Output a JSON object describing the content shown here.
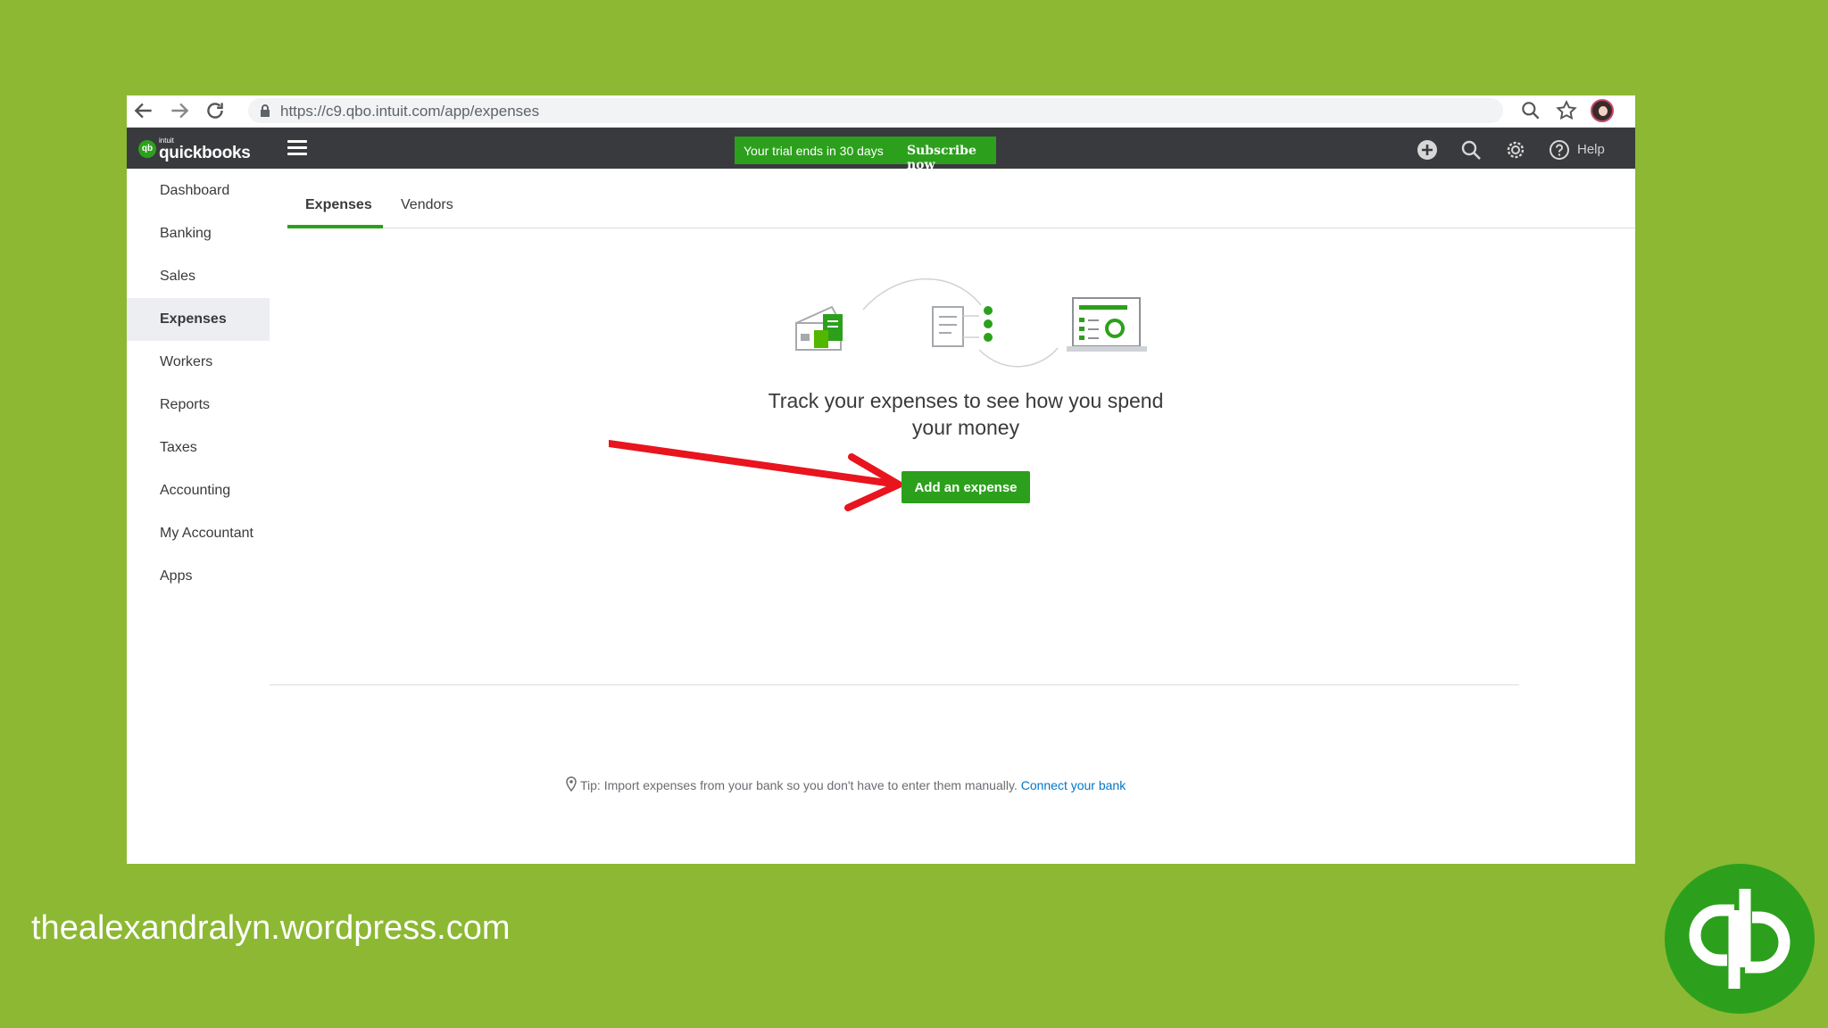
{
  "browser": {
    "url": "https://c9.qbo.intuit.com/app/expenses"
  },
  "topbar": {
    "logo_small": "intuit",
    "logo_text": "quickbooks",
    "logo_mark": "qb",
    "trial_text": "Your trial ends in 30 days",
    "subscribe_label": "Subscribe now",
    "help_label": "Help"
  },
  "sidebar": {
    "items": [
      {
        "label": "Dashboard"
      },
      {
        "label": "Banking"
      },
      {
        "label": "Sales"
      },
      {
        "label": "Expenses"
      },
      {
        "label": "Workers"
      },
      {
        "label": "Reports"
      },
      {
        "label": "Taxes"
      },
      {
        "label": "Accounting"
      },
      {
        "label": "My Accountant"
      },
      {
        "label": "Apps"
      }
    ]
  },
  "tabs": [
    {
      "label": "Expenses"
    },
    {
      "label": "Vendors"
    }
  ],
  "main": {
    "headline": "Track your expenses to see how you spend your money",
    "add_button": "Add an expense",
    "tip_text": "Tip: Import expenses from your bank so you don't have to enter them manually.",
    "tip_link": "Connect your bank"
  },
  "overlay": {
    "watermark": "thealexandralyn.wordpress.com"
  },
  "colors": {
    "background": "#8cb833",
    "brand_green": "#2ca01c",
    "navbar": "#393a3d",
    "arrow": "#e8141e",
    "link": "#0077c5"
  },
  "icons": [
    "back-arrow-icon",
    "forward-arrow-icon",
    "reload-icon",
    "lock-icon",
    "zoom-icon",
    "star-icon",
    "plus-circle-icon",
    "search-icon",
    "gear-icon",
    "help-icon",
    "map-pin-icon"
  ]
}
